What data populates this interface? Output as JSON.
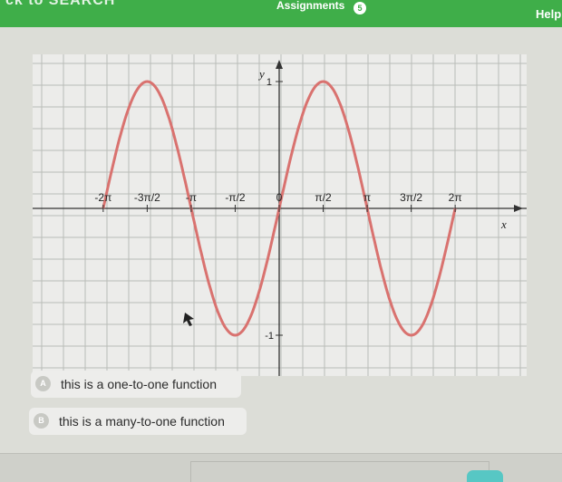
{
  "header": {
    "back_text": "ck to SEARCH",
    "assignments_label": "Assignments",
    "assignments_count": "5",
    "help_label": "Help"
  },
  "graph": {
    "y_axis_label": "y",
    "x_axis_label": "x",
    "y_tick_top": "1",
    "y_tick_bottom": "-1",
    "x_ticks": [
      "-2π",
      "-3π/2",
      "-π",
      "-π/2",
      "0",
      "π/2",
      "π",
      "3π/2",
      "2π"
    ],
    "curve_color": "#d9726f"
  },
  "choices": [
    {
      "letter": "A",
      "text": "this is a one-to-one function"
    },
    {
      "letter": "B",
      "text": "this is a many-to-one function"
    }
  ],
  "chart_data": {
    "type": "line",
    "function": "sin(x)",
    "xlim": [
      "-2π",
      "2π"
    ],
    "ylim": [
      -1,
      1
    ],
    "grid": true,
    "series": [
      {
        "values_description": "",
        "x": [
          -6.283,
          -5.498,
          -4.712,
          -3.927,
          -3.142,
          -2.356,
          -1.571,
          -0.785,
          0,
          0.785,
          1.571,
          2.356,
          3.142,
          3.927,
          4.712,
          5.498,
          6.283
        ],
        "y": [
          0,
          0.707,
          1,
          0.707,
          0,
          -0.707,
          -1,
          -0.707,
          0,
          0.707,
          1,
          0.707,
          0,
          -0.707,
          -1,
          -0.707,
          0
        ]
      }
    ]
  }
}
